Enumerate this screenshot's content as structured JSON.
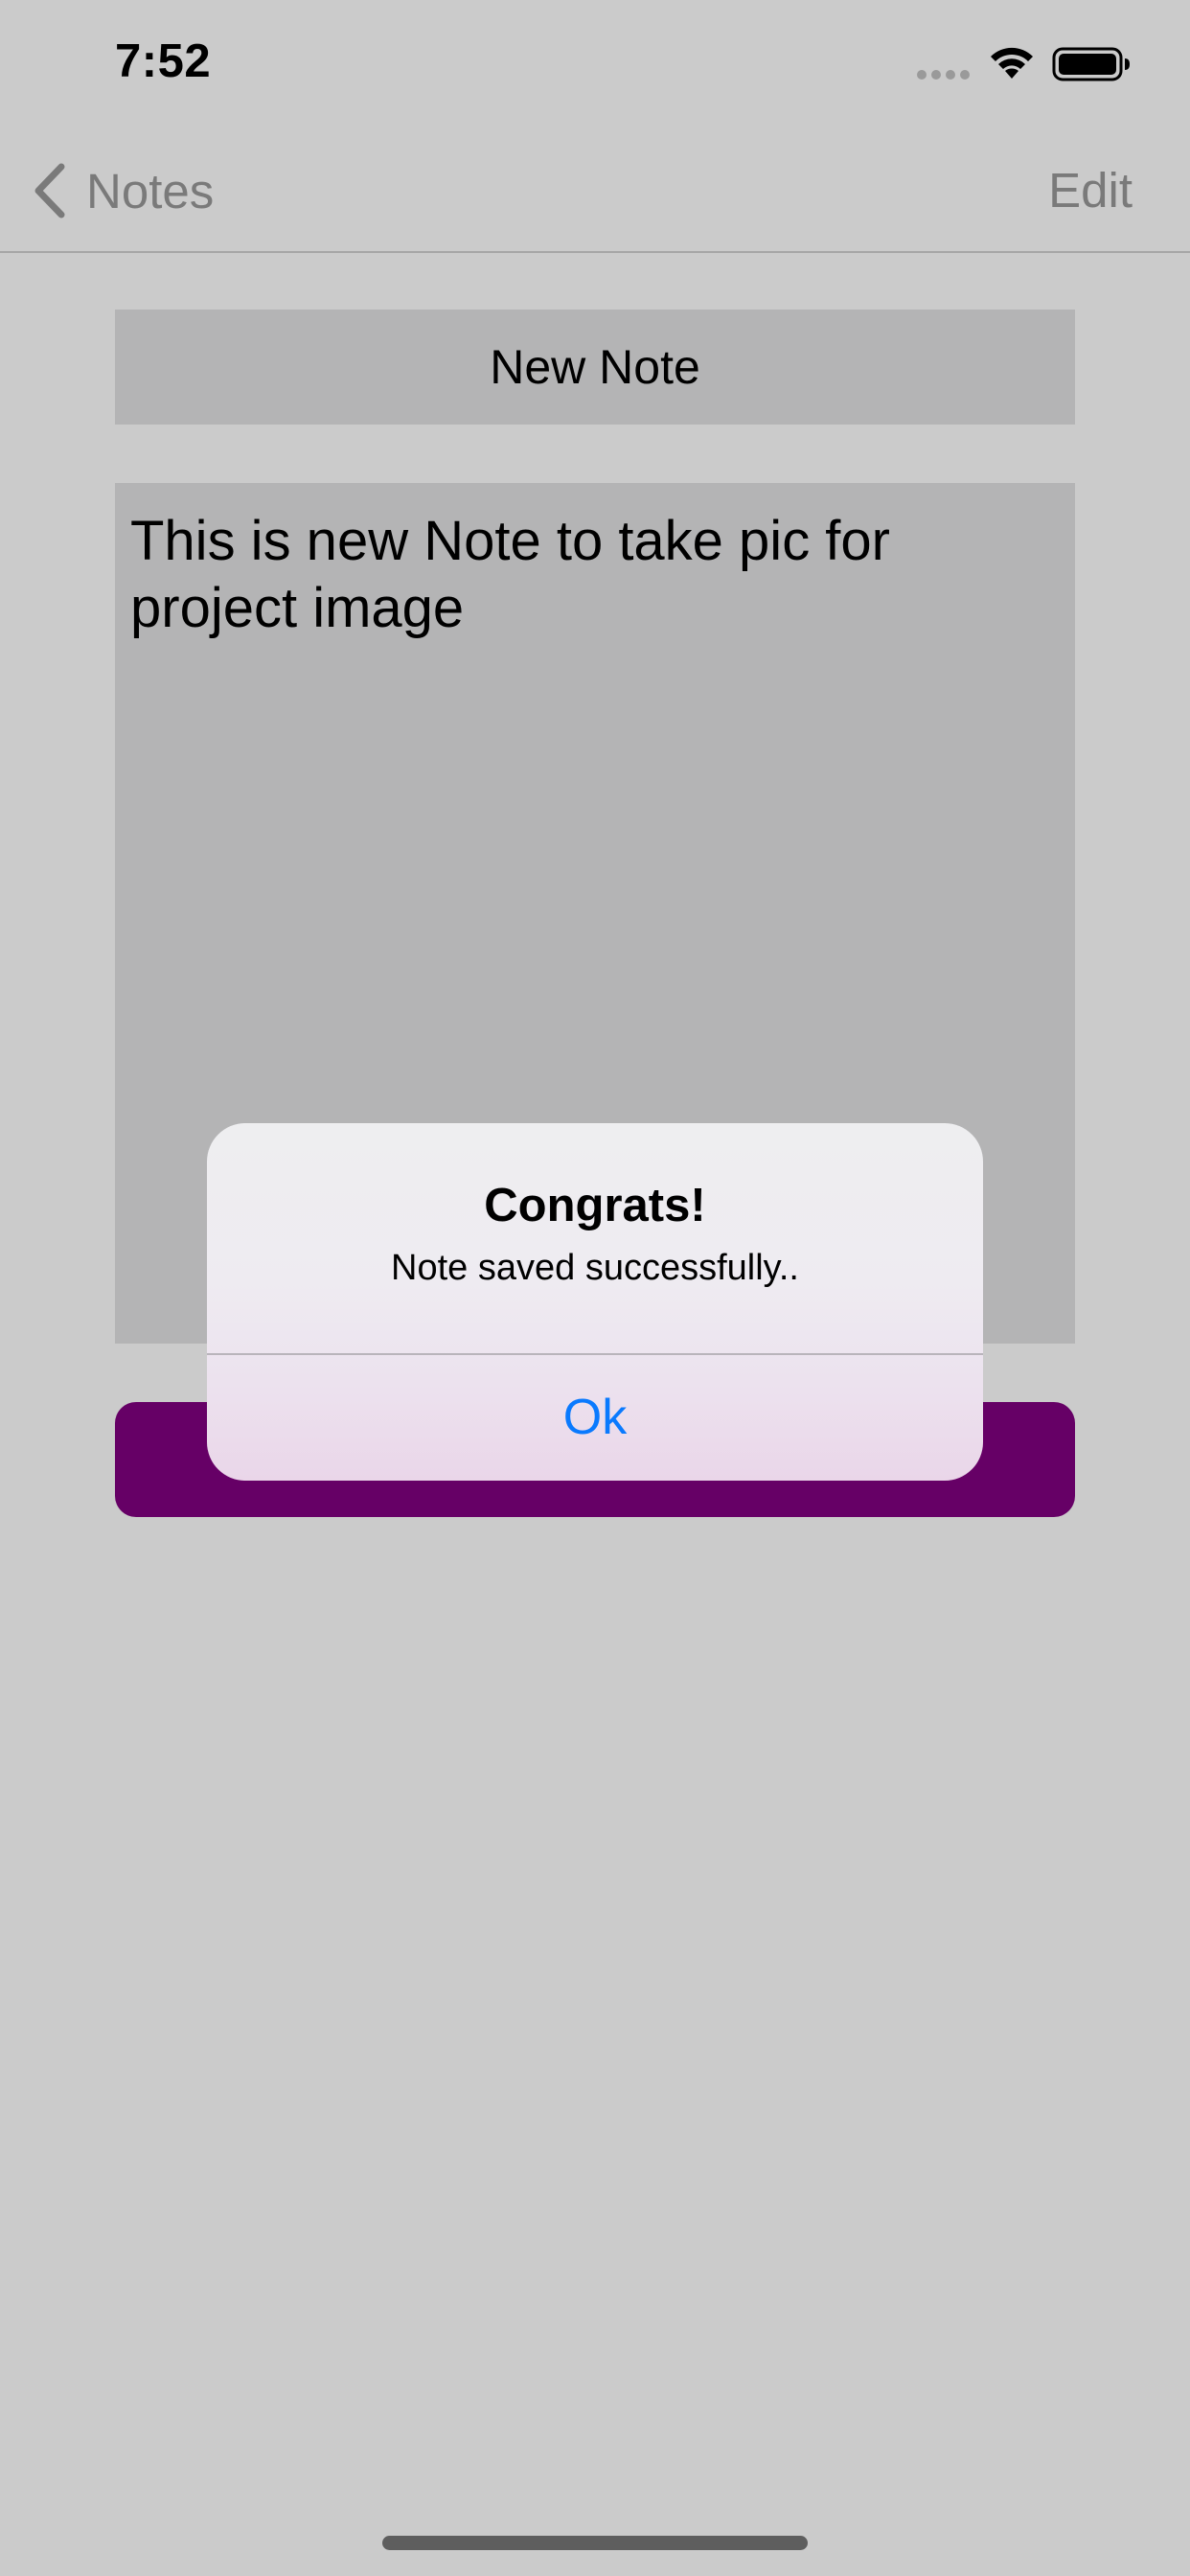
{
  "status_bar": {
    "time": "7:52"
  },
  "nav": {
    "back_label": "Notes",
    "edit_label": "Edit"
  },
  "note": {
    "title_value": "New Note",
    "body_value": "This is new Note to take pic for project image"
  },
  "alert": {
    "title": "Congrats!",
    "message": "Note saved successfully..",
    "ok_label": "Ok"
  },
  "colors": {
    "background": "#cbcbcb",
    "field_background": "#b4b4b5",
    "save_button": "#660066",
    "alert_action": "#0a7afe",
    "nav_text": "#7a7a7a"
  },
  "icons": {
    "back": "chevron-left-icon",
    "signal": "cellular-signal-icon",
    "wifi": "wifi-icon",
    "battery": "battery-icon"
  }
}
